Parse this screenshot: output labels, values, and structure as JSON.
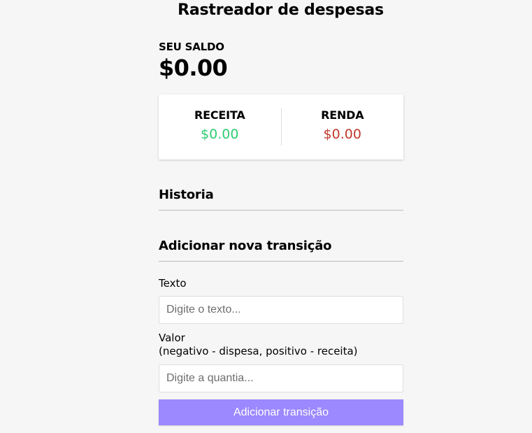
{
  "header": {
    "title": "Rastreador de despesas"
  },
  "balance": {
    "label": "SEU SALDO",
    "value": "$0.00"
  },
  "summary": {
    "income_label": "RECEITA",
    "income_value": "$0.00",
    "expense_label": "RENDA",
    "expense_value": "$0.00"
  },
  "history": {
    "title": "Historia"
  },
  "form": {
    "title": "Adicionar nova transição",
    "text_label": "Texto",
    "text_placeholder": "Digite o texto...",
    "amount_label": "Valor",
    "amount_hint": "(negativo - dispesa, positivo - receita)",
    "amount_placeholder": "Digite a quantia...",
    "submit_label": "Adicionar transição"
  },
  "colors": {
    "income": "#2ecc71",
    "expense": "#c0392b",
    "button": "#9c88ff",
    "background": "#f6f6f6"
  }
}
